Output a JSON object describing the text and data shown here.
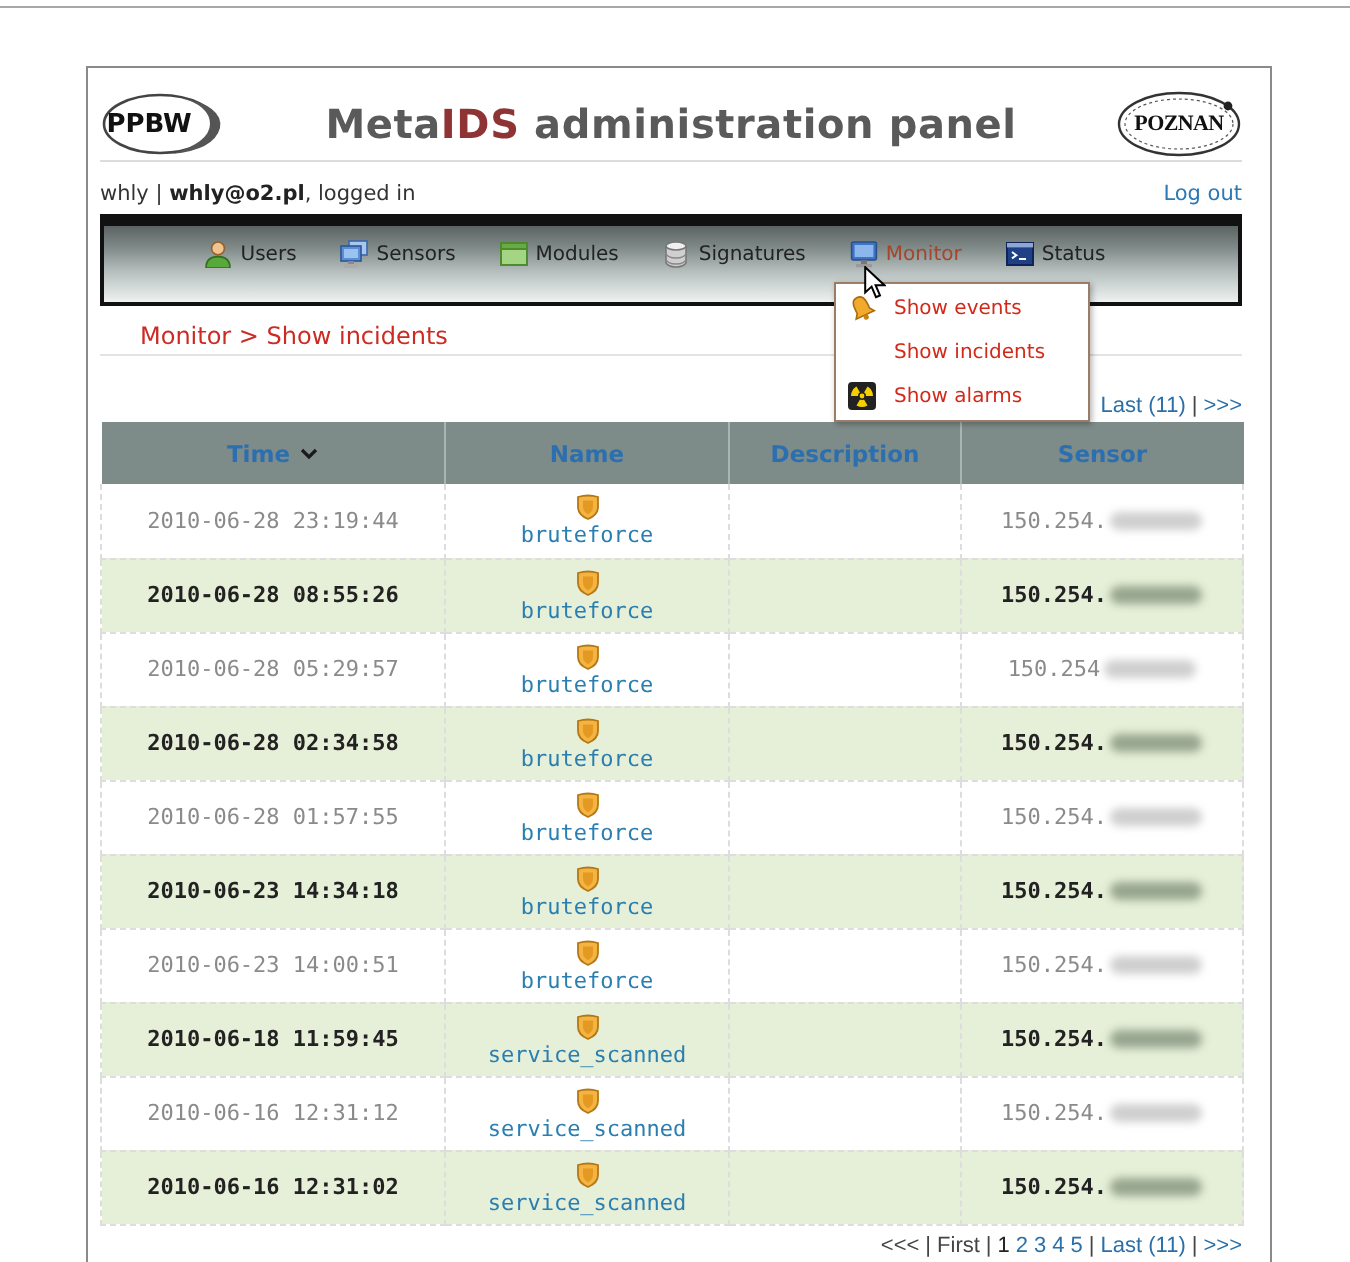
{
  "header": {
    "left_logo": {
      "text": "PPBW"
    },
    "title": [
      {
        "text": "Meta",
        "highlight": false
      },
      {
        "text": "IDS",
        "highlight": true
      },
      {
        "text": " administration panel",
        "highlight": false
      }
    ],
    "right_logo": {
      "text": "POZNAN"
    }
  },
  "user_bar": {
    "login_info": "whly | **whly@o2.pl**, logged in",
    "logout": "Log out"
  },
  "nav": {
    "items": [
      {
        "label": "Users",
        "selected": false
      },
      {
        "label": "Sensors",
        "selected": false
      },
      {
        "label": "Modules",
        "selected": false
      },
      {
        "label": "Signatures",
        "selected": false
      },
      {
        "label": "Monitor",
        "selected": true,
        "menu": [
          {
            "label": "Show events"
          },
          {
            "label": "Show incidents"
          },
          {
            "label": "Show alarms"
          }
        ]
      },
      {
        "label": "Status",
        "selected": false
      }
    ]
  },
  "breadcrumb": "Monitor > Show incidents",
  "pagination_top": [
    {
      "kind": "nav",
      "label": "Last (11)",
      "disabled": false
    },
    {
      "kind": "separator",
      "label": "|"
    },
    {
      "kind": "nav",
      "label": ">>>",
      "disabled": false
    }
  ],
  "table": {
    "columns": [
      {
        "label": "Time",
        "sorted": true
      },
      {
        "label": "Name",
        "sorted": false
      },
      {
        "label": "Description",
        "sorted": false
      },
      {
        "label": "Sensor",
        "sorted": false
      }
    ],
    "rows": [
      {
        "time": "2010-06-28 23:19:44",
        "name": "bruteforce",
        "sensor": "150.254."
      },
      {
        "time": "2010-06-28 08:55:26",
        "name": "bruteforce",
        "sensor": "150.254."
      },
      {
        "time": "2010-06-28 05:29:57",
        "name": "bruteforce",
        "sensor": "150.254"
      },
      {
        "time": "2010-06-28 02:34:58",
        "name": "bruteforce",
        "sensor": "150.254."
      },
      {
        "time": "2010-06-28 01:57:55",
        "name": "bruteforce",
        "sensor": "150.254."
      },
      {
        "time": "2010-06-23 14:34:18",
        "name": "bruteforce",
        "sensor": "150.254."
      },
      {
        "time": "2010-06-23 14:00:51",
        "name": "bruteforce",
        "sensor": "150.254."
      },
      {
        "time": "2010-06-18 11:59:45",
        "name": "service_scanned",
        "sensor": "150.254."
      },
      {
        "time": "2010-06-16 12:31:12",
        "name": "service_scanned",
        "sensor": "150.254."
      },
      {
        "time": "2010-06-16 12:31:02",
        "name": "service_scanned",
        "sensor": "150.254."
      }
    ]
  },
  "pagination_bottom": [
    {
      "kind": "nav",
      "label": "<<<",
      "disabled": true
    },
    {
      "kind": "separator",
      "label": "|"
    },
    {
      "kind": "nav",
      "label": "First",
      "disabled": true
    },
    {
      "kind": "separator",
      "label": "|"
    },
    {
      "kind": "page",
      "label": "1",
      "selected": true
    },
    {
      "kind": "page",
      "label": "2",
      "selected": false
    },
    {
      "kind": "page",
      "label": "3",
      "selected": false
    },
    {
      "kind": "page",
      "label": "4",
      "selected": false
    },
    {
      "kind": "page",
      "label": "5",
      "selected": false
    },
    {
      "kind": "separator",
      "label": "|"
    },
    {
      "kind": "nav",
      "label": "Last (11)",
      "disabled": false
    },
    {
      "kind": "separator",
      "label": "|"
    },
    {
      "kind": "nav",
      "label": ">>>",
      "disabled": false
    }
  ]
}
